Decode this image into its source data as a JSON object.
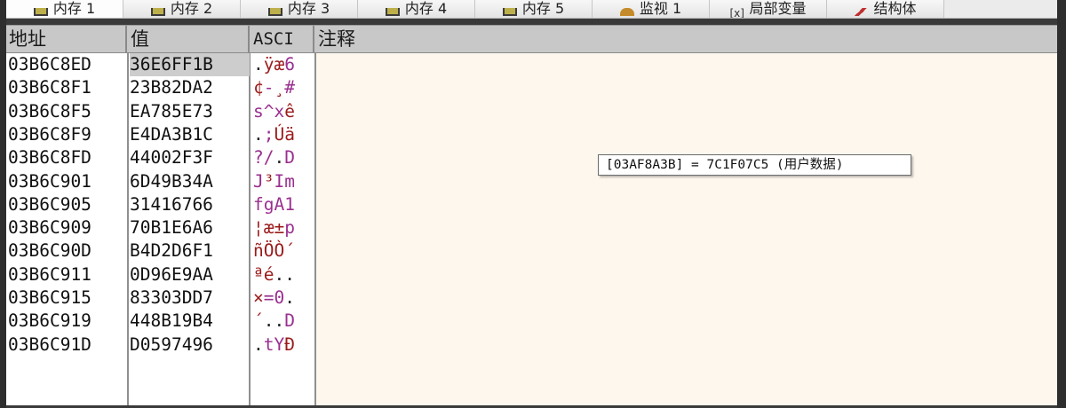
{
  "tabs": [
    {
      "label": "内存 1",
      "icon": "memory-chip-icon",
      "active": true
    },
    {
      "label": "内存 2",
      "icon": "memory-chip-icon"
    },
    {
      "label": "内存 3",
      "icon": "memory-chip-icon"
    },
    {
      "label": "内存 4",
      "icon": "memory-chip-icon"
    },
    {
      "label": "内存 5",
      "icon": "memory-chip-icon"
    },
    {
      "label": "监视 1",
      "icon": "watch-icon"
    },
    {
      "label": "局部变量",
      "icon": "local-vars-icon"
    },
    {
      "label": "结构体",
      "icon": "struct-icon"
    }
  ],
  "columns": {
    "address": "地址",
    "value": "值",
    "ascii": "ASCI",
    "comment": "注释"
  },
  "rows": [
    {
      "address": "03B6C8ED",
      "value": "36E6FF1B",
      "ascii": ".ÿæ6",
      "selected": true
    },
    {
      "address": "03B6C8F1",
      "value": "23B82DA2",
      "ascii": "¢-¸#"
    },
    {
      "address": "03B6C8F5",
      "value": "EA785E73",
      "ascii": "s^xê"
    },
    {
      "address": "03B6C8F9",
      "value": "E4DA3B1C",
      "ascii": ".;Úä"
    },
    {
      "address": "03B6C8FD",
      "value": "44002F3F",
      "ascii": "?/.D"
    },
    {
      "address": "03B6C901",
      "value": "6D49B34A",
      "ascii": "J³Im"
    },
    {
      "address": "03B6C905",
      "value": "31416766",
      "ascii": "fgA1"
    },
    {
      "address": "03B6C909",
      "value": "70B1E6A6",
      "ascii": "¦æ±p"
    },
    {
      "address": "03B6C90D",
      "value": "B4D2D6F1",
      "ascii": "ñÖÒ´"
    },
    {
      "address": "03B6C911",
      "value": "0D96E9AA",
      "ascii": "ªé.."
    },
    {
      "address": "03B6C915",
      "value": "83303DD7",
      "ascii": "×=0."
    },
    {
      "address": "03B6C919",
      "value": "448B19B4",
      "ascii": "´..D"
    },
    {
      "address": "03B6C91D",
      "value": "D0597496",
      "ascii": ".tYÐ"
    }
  ],
  "tooltip": "[03AF8A3B] = 7C1F07C5 (用户数据)",
  "colors": {
    "ascii_printable": "#9a2f8f",
    "ascii_extended": "#9b1b1b",
    "ascii_control": "#222222",
    "comment_bg": "#fdf7ed"
  }
}
